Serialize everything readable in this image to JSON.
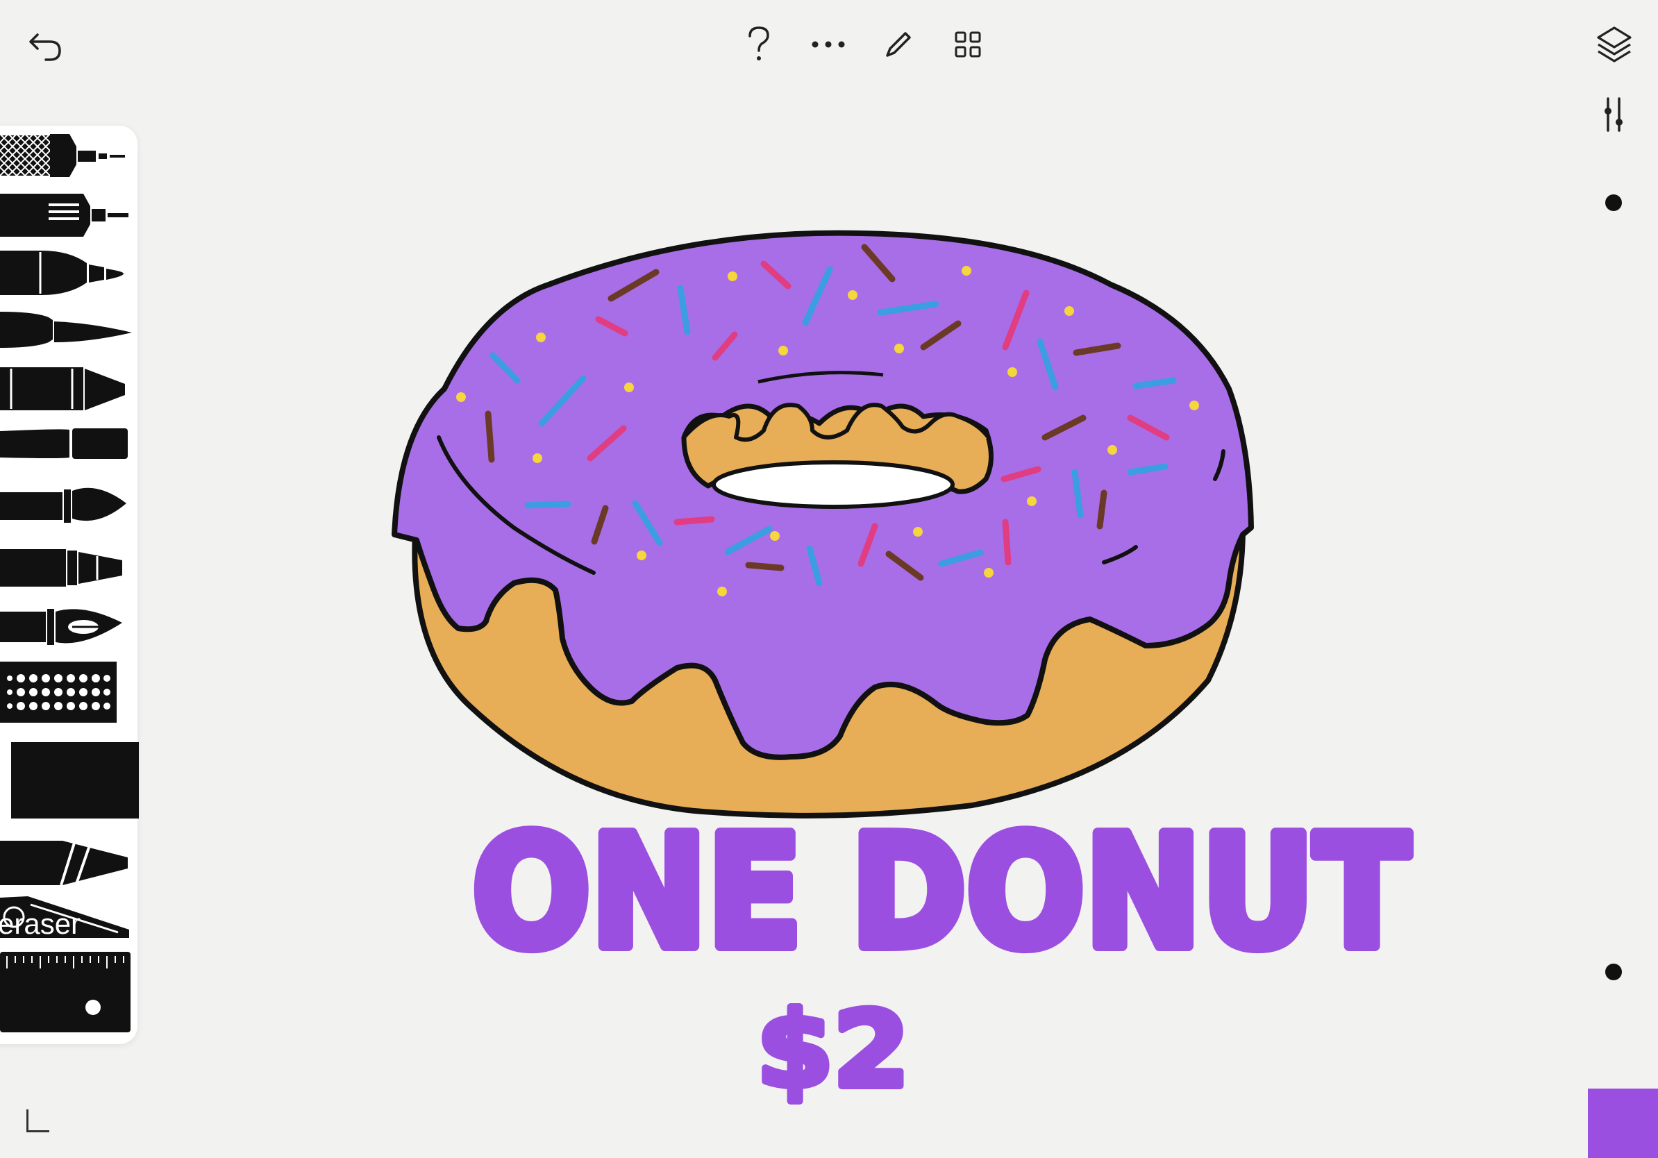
{
  "toolbar": {
    "undo_icon": "undo-arrow-icon",
    "help_icon": "question-mark-icon",
    "more_icon": "ellipsis-icon",
    "draw_icon": "pencil-icon",
    "grid_icon": "grid-icon",
    "layers_icon": "layers-icon",
    "adjust_icon": "sliders-icon"
  },
  "tools": {
    "eraser_label": "eraser",
    "eraser_accent_color": "#e8374f"
  },
  "canvas": {
    "headline": "ONE DONUT",
    "price": "$2",
    "text_color": "#9b4fe0",
    "glaze_color": "#a86ee8",
    "dough_color": "#e8ad57"
  },
  "current_color": "#9b4fe0"
}
